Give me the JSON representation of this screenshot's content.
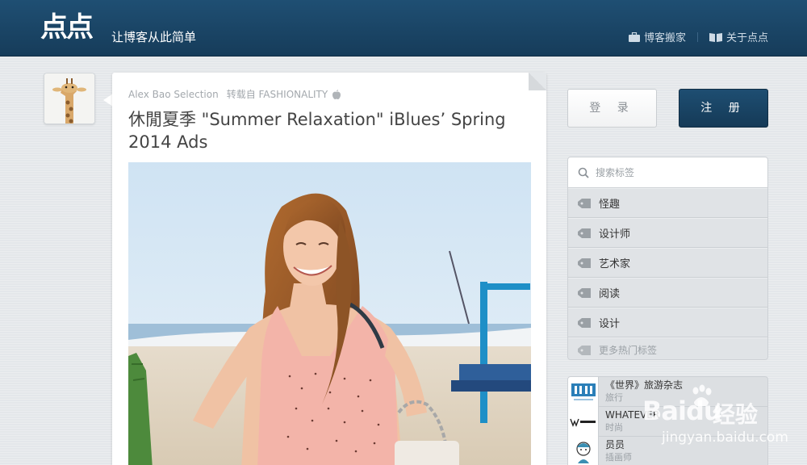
{
  "header": {
    "logo": "点点",
    "slogan": "让博客从此简单",
    "nav": [
      {
        "label": "博客搬家",
        "icon": "briefcase-icon"
      },
      {
        "label": "关于点点",
        "icon": "book-icon"
      }
    ]
  },
  "post": {
    "author": "Alex Bao Selection",
    "source": "转载自 FASHIONALITY",
    "source_icon": "apple-icon",
    "title": "休閒夏季 \"Summer Relaxation\" iBlues’ Spring 2014 Ads"
  },
  "auth": {
    "login_label": "登 录",
    "register_label": "注 册"
  },
  "tags": {
    "search_placeholder": "搜索标签",
    "items": [
      "怪趣",
      "设计师",
      "艺术家",
      "阅读",
      "设计"
    ],
    "more_label": "更多热门标签"
  },
  "recommendations": [
    {
      "name": "《世界》旅游杂志",
      "category": "旅行"
    },
    {
      "name": "WHATEVER",
      "category": "时尚"
    },
    {
      "name": "员员",
      "category": "插画师"
    }
  ],
  "watermark": {
    "brand": "Baidu",
    "cn": "经验",
    "url": "jingyan.baidu.com"
  },
  "colors": {
    "header_bg": "#1a4566",
    "register_bg": "#1a4566",
    "page_bg": "#e4e7ea"
  }
}
